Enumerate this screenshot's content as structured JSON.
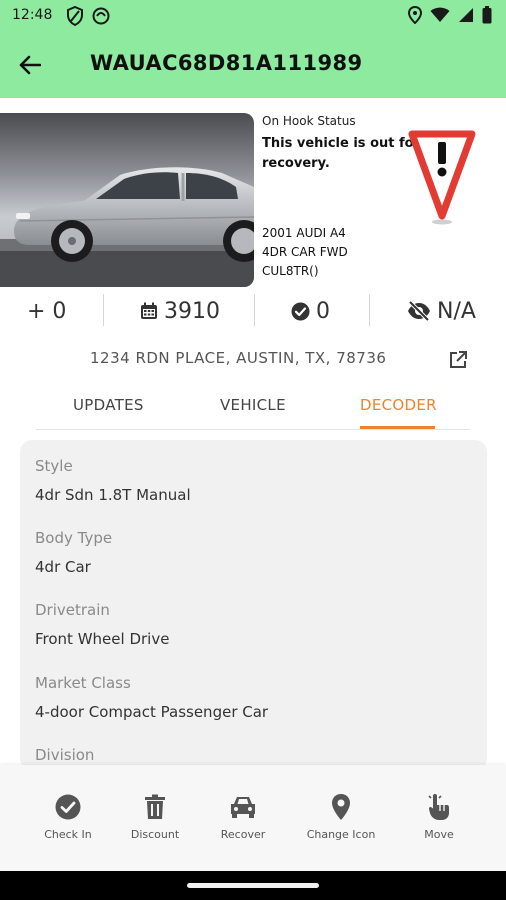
{
  "status_bar": {
    "time": "12:48",
    "left_icons": [
      "vpn-shield-icon",
      "notification-app-icon"
    ],
    "right_icons": [
      "location-icon",
      "wifi-icon",
      "signal-icon",
      "battery-icon"
    ]
  },
  "app_bar": {
    "title": "WAUAC68D81A111989",
    "back_icon": "arrow-left-icon",
    "background": "#8eea9f"
  },
  "vehicle": {
    "photo": "silver-sedan-photo",
    "on_hook_label": "On Hook Status",
    "on_hook_status": "This vehicle is out for recovery.",
    "year_make_model": "2001 AUDI A4",
    "body": "4DR CAR FWD",
    "plate": "CUL8TR()",
    "warning_icon": "warning-yield-icon"
  },
  "stats": {
    "add": "+ 0",
    "calendar": "3910",
    "checks": "0",
    "visibility": "N/A"
  },
  "address": {
    "text": "1234 RDN PLACE, AUSTIN, TX, 78736",
    "link_icon": "open-in-new-icon"
  },
  "tabs": {
    "updates": "UPDATES",
    "vehicle": "VEHICLE",
    "decoder": "DECODER",
    "active": "decoder",
    "accent": "#f0822c"
  },
  "decoder": {
    "fields": [
      {
        "label": "Style",
        "value": "4dr Sdn 1.8T Manual"
      },
      {
        "label": "Body Type",
        "value": "4dr Car"
      },
      {
        "label": "Drivetrain",
        "value": "Front Wheel Drive"
      },
      {
        "label": "Market Class",
        "value": "4-door Compact Passenger Car"
      },
      {
        "label": "Division",
        "value": ""
      }
    ]
  },
  "bottom_nav": {
    "items": [
      {
        "label": "Check In",
        "icon": "check-circle-icon"
      },
      {
        "label": "Discount",
        "icon": "trash-icon"
      },
      {
        "label": "Recover",
        "icon": "car-icon"
      },
      {
        "label": "Change Icon",
        "icon": "map-pin-icon"
      },
      {
        "label": "Move",
        "icon": "hand-pointer-icon"
      }
    ]
  }
}
